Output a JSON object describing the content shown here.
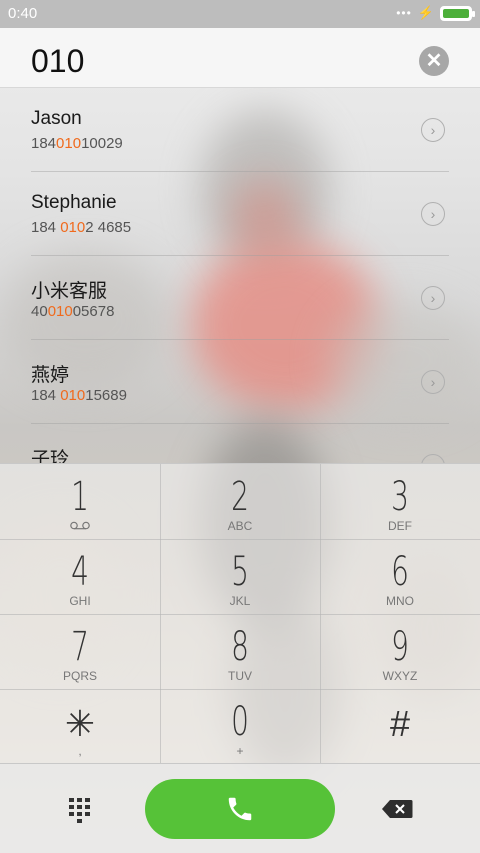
{
  "status": {
    "time": "0:40",
    "dots": "•••",
    "bolt": "⚡"
  },
  "header": {
    "dialed_number": "010",
    "clear_glyph": "✕"
  },
  "contacts": [
    {
      "name": "Jason",
      "num_pre": "184",
      "num_hl": "010",
      "num_post": "10029"
    },
    {
      "name": "Stephanie",
      "num_pre": "184 ",
      "num_hl": "010",
      "num_post": "2 4685"
    },
    {
      "name": "小米客服",
      "num_pre": "40",
      "num_hl": "010",
      "num_post": "05678"
    },
    {
      "name": "燕婷",
      "num_pre": "184 ",
      "num_hl": "010",
      "num_post": "15689"
    },
    {
      "name": "子玲",
      "num_pre": "",
      "num_hl": "",
      "num_post": ""
    }
  ],
  "keys": [
    {
      "digit": "1",
      "letters": ""
    },
    {
      "digit": "2",
      "letters": "ABC"
    },
    {
      "digit": "3",
      "letters": "DEF"
    },
    {
      "digit": "4",
      "letters": "GHI"
    },
    {
      "digit": "5",
      "letters": "JKL"
    },
    {
      "digit": "6",
      "letters": "MNO"
    },
    {
      "digit": "7",
      "letters": "PQRS"
    },
    {
      "digit": "8",
      "letters": "TUV"
    },
    {
      "digit": "9",
      "letters": "WXYZ"
    },
    {
      "digit": "✳",
      "letters": ","
    },
    {
      "digit": "0",
      "letters": "+"
    },
    {
      "digit": "#",
      "letters": ""
    }
  ],
  "icons": {
    "voicemail": "voicemail-icon",
    "dialpad": "dialpad-grid-icon",
    "call": "phone-icon",
    "delete": "backspace-icon",
    "clear": "clear-icon",
    "arrow": "chevron-right-icon"
  },
  "colors": {
    "highlight": "#f06a1d",
    "call_green": "#56c238",
    "battery_green": "#4caf3a"
  }
}
